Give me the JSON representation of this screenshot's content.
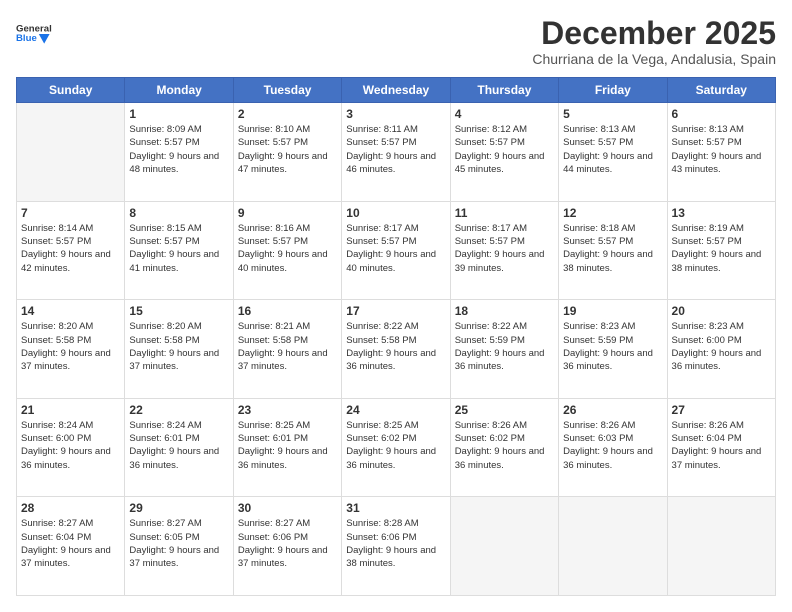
{
  "header": {
    "logo_general": "General",
    "logo_blue": "Blue",
    "month": "December 2025",
    "location": "Churriana de la Vega, Andalusia, Spain"
  },
  "weekdays": [
    "Sunday",
    "Monday",
    "Tuesday",
    "Wednesday",
    "Thursday",
    "Friday",
    "Saturday"
  ],
  "weeks": [
    [
      {
        "day": "",
        "sunrise": "",
        "sunset": "",
        "daylight": ""
      },
      {
        "day": "1",
        "sunrise": "8:09 AM",
        "sunset": "5:57 PM",
        "daylight": "9 hours and 48 minutes."
      },
      {
        "day": "2",
        "sunrise": "8:10 AM",
        "sunset": "5:57 PM",
        "daylight": "9 hours and 47 minutes."
      },
      {
        "day": "3",
        "sunrise": "8:11 AM",
        "sunset": "5:57 PM",
        "daylight": "9 hours and 46 minutes."
      },
      {
        "day": "4",
        "sunrise": "8:12 AM",
        "sunset": "5:57 PM",
        "daylight": "9 hours and 45 minutes."
      },
      {
        "day": "5",
        "sunrise": "8:13 AM",
        "sunset": "5:57 PM",
        "daylight": "9 hours and 44 minutes."
      },
      {
        "day": "6",
        "sunrise": "8:13 AM",
        "sunset": "5:57 PM",
        "daylight": "9 hours and 43 minutes."
      }
    ],
    [
      {
        "day": "7",
        "sunrise": "8:14 AM",
        "sunset": "5:57 PM",
        "daylight": "9 hours and 42 minutes."
      },
      {
        "day": "8",
        "sunrise": "8:15 AM",
        "sunset": "5:57 PM",
        "daylight": "9 hours and 41 minutes."
      },
      {
        "day": "9",
        "sunrise": "8:16 AM",
        "sunset": "5:57 PM",
        "daylight": "9 hours and 40 minutes."
      },
      {
        "day": "10",
        "sunrise": "8:17 AM",
        "sunset": "5:57 PM",
        "daylight": "9 hours and 40 minutes."
      },
      {
        "day": "11",
        "sunrise": "8:17 AM",
        "sunset": "5:57 PM",
        "daylight": "9 hours and 39 minutes."
      },
      {
        "day": "12",
        "sunrise": "8:18 AM",
        "sunset": "5:57 PM",
        "daylight": "9 hours and 38 minutes."
      },
      {
        "day": "13",
        "sunrise": "8:19 AM",
        "sunset": "5:57 PM",
        "daylight": "9 hours and 38 minutes."
      }
    ],
    [
      {
        "day": "14",
        "sunrise": "8:20 AM",
        "sunset": "5:58 PM",
        "daylight": "9 hours and 37 minutes."
      },
      {
        "day": "15",
        "sunrise": "8:20 AM",
        "sunset": "5:58 PM",
        "daylight": "9 hours and 37 minutes."
      },
      {
        "day": "16",
        "sunrise": "8:21 AM",
        "sunset": "5:58 PM",
        "daylight": "9 hours and 37 minutes."
      },
      {
        "day": "17",
        "sunrise": "8:22 AM",
        "sunset": "5:58 PM",
        "daylight": "9 hours and 36 minutes."
      },
      {
        "day": "18",
        "sunrise": "8:22 AM",
        "sunset": "5:59 PM",
        "daylight": "9 hours and 36 minutes."
      },
      {
        "day": "19",
        "sunrise": "8:23 AM",
        "sunset": "5:59 PM",
        "daylight": "9 hours and 36 minutes."
      },
      {
        "day": "20",
        "sunrise": "8:23 AM",
        "sunset": "6:00 PM",
        "daylight": "9 hours and 36 minutes."
      }
    ],
    [
      {
        "day": "21",
        "sunrise": "8:24 AM",
        "sunset": "6:00 PM",
        "daylight": "9 hours and 36 minutes."
      },
      {
        "day": "22",
        "sunrise": "8:24 AM",
        "sunset": "6:01 PM",
        "daylight": "9 hours and 36 minutes."
      },
      {
        "day": "23",
        "sunrise": "8:25 AM",
        "sunset": "6:01 PM",
        "daylight": "9 hours and 36 minutes."
      },
      {
        "day": "24",
        "sunrise": "8:25 AM",
        "sunset": "6:02 PM",
        "daylight": "9 hours and 36 minutes."
      },
      {
        "day": "25",
        "sunrise": "8:26 AM",
        "sunset": "6:02 PM",
        "daylight": "9 hours and 36 minutes."
      },
      {
        "day": "26",
        "sunrise": "8:26 AM",
        "sunset": "6:03 PM",
        "daylight": "9 hours and 36 minutes."
      },
      {
        "day": "27",
        "sunrise": "8:26 AM",
        "sunset": "6:04 PM",
        "daylight": "9 hours and 37 minutes."
      }
    ],
    [
      {
        "day": "28",
        "sunrise": "8:27 AM",
        "sunset": "6:04 PM",
        "daylight": "9 hours and 37 minutes."
      },
      {
        "day": "29",
        "sunrise": "8:27 AM",
        "sunset": "6:05 PM",
        "daylight": "9 hours and 37 minutes."
      },
      {
        "day": "30",
        "sunrise": "8:27 AM",
        "sunset": "6:06 PM",
        "daylight": "9 hours and 37 minutes."
      },
      {
        "day": "31",
        "sunrise": "8:28 AM",
        "sunset": "6:06 PM",
        "daylight": "9 hours and 38 minutes."
      },
      {
        "day": "",
        "sunrise": "",
        "sunset": "",
        "daylight": ""
      },
      {
        "day": "",
        "sunrise": "",
        "sunset": "",
        "daylight": ""
      },
      {
        "day": "",
        "sunrise": "",
        "sunset": "",
        "daylight": ""
      }
    ]
  ]
}
